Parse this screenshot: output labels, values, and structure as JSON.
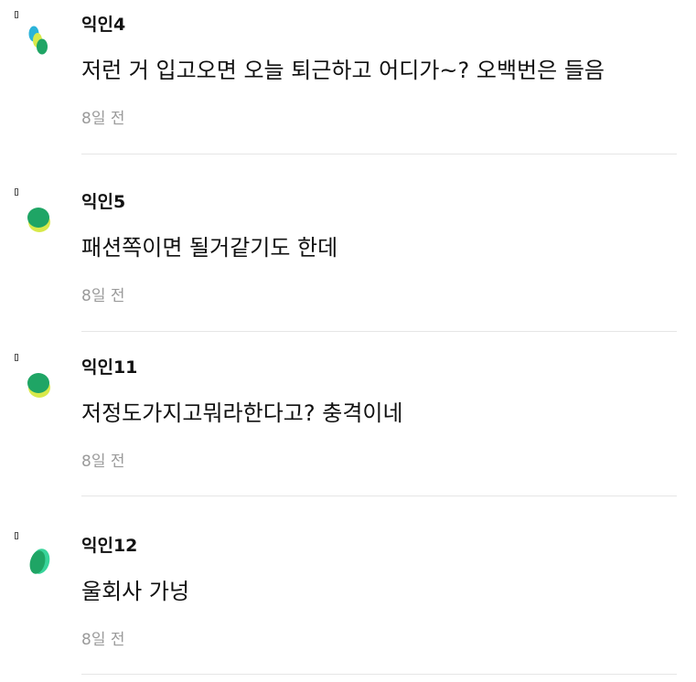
{
  "comments": [
    {
      "author": "익인4",
      "text": "저런 거 입고오면 오늘 퇴근하고 어디가~? 오백번은 들음",
      "time": "8일 전",
      "avatar": "teal-yellow-green-blob-icon"
    },
    {
      "author": "익인5",
      "text": "패션쪽이면 될거같기도 한데",
      "time": "8일 전",
      "avatar": "green-yellow-blob-icon"
    },
    {
      "author": "익인11",
      "text": "저정도가지고뭐라한다고? 충격이네",
      "time": "8일 전",
      "avatar": "green-yellow-blob-icon"
    },
    {
      "author": "익인12",
      "text": "울회사 가넝",
      "time": "8일 전",
      "avatar": "mint-green-blob-icon"
    }
  ],
  "colors": {
    "text": "#111111",
    "time": "#9a9a9a",
    "divider": "#e6e6e6",
    "avatar_teal": "#2bb3d9",
    "avatar_yellow": "#d8e94a",
    "avatar_green": "#1fa565",
    "avatar_mint": "#38d49a"
  }
}
